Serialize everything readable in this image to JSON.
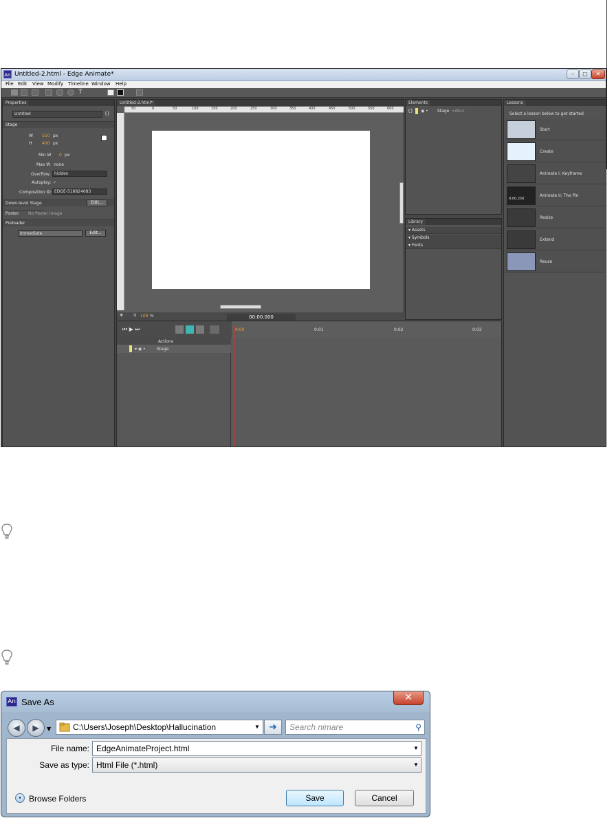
{
  "edge": {
    "title": "Untitled-2.html - Edge Animate*",
    "logo": "An",
    "menu": [
      "File",
      "Edit",
      "View",
      "Modify",
      "Timeline",
      "Window",
      "Help"
    ],
    "properties": {
      "tab": "Properties",
      "name": "Untitled",
      "stage_section": "Stage",
      "w_label": "W",
      "w_value": "550",
      "h_label": "H",
      "h_value": "400",
      "unit": "px",
      "min_w_label": "Min W",
      "min_w_value": "0",
      "max_w_label": "Max W",
      "max_w_value": "none",
      "overflow_label": "Overflow:",
      "overflow_value": "hidden",
      "autoplay_label": "Autoplay:",
      "autoplay_value": "✓",
      "composition_label": "Composition ID:",
      "composition_value": "EDGE-518824683",
      "down_level_label": "Down-level Stage",
      "edit_label": "Edit...",
      "poster_label": "Poster:",
      "poster_value": "No Poster Image",
      "preloader_label": "Preloader",
      "preloader_value": "Immediate"
    },
    "stage": {
      "tab": "Untitled-2.html*",
      "ruler_ticks": [
        "50",
        "0",
        "50",
        "100",
        "150",
        "200",
        "250",
        "300",
        "350",
        "400",
        "450",
        "500",
        "550",
        "600"
      ],
      "zoom": "100",
      "zoom_unit": "%"
    },
    "elements": {
      "tab": "Elements",
      "stage_label": "Stage",
      "stage_tag": "<div>"
    },
    "library": {
      "tab": "Library",
      "items": [
        "Assets",
        "Symbols",
        "Fonts"
      ]
    },
    "lessons": {
      "tab": "Lessons",
      "intro": "Select a lesson below to get started",
      "items": [
        "Start",
        "Create",
        "Animate I: Keyframe",
        "Animate II: The Pin",
        "Resize",
        "Extend",
        "Reuse"
      ],
      "pin_time": "0:00.250"
    },
    "timeline": {
      "time": "00:00.000",
      "actions_label": "Actions",
      "stage_label": "Stage",
      "ticks": [
        "0:00",
        "0:01",
        "0:02",
        "0:03"
      ]
    }
  },
  "dialog": {
    "title": "Save As",
    "logo": "An",
    "close": "✕",
    "path": "C:\\Users\\Joseph\\Desktop\\Hallucination",
    "search_placeholder": "Search nimare",
    "file_name_label": "File name:",
    "file_name_value": "EdgeAnimateProject.html",
    "save_type_label": "Save as type:",
    "save_type_value": "Html File (*.html)",
    "browse_label": "Browse Folders",
    "save_label": "Save",
    "cancel_label": "Cancel"
  }
}
